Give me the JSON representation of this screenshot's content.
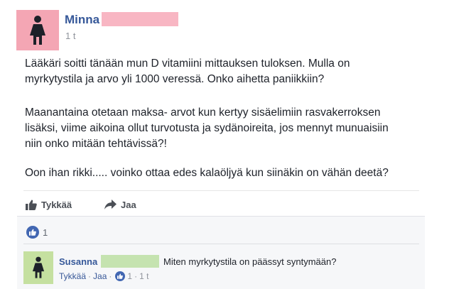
{
  "post": {
    "author": "Minna",
    "time": "1 t",
    "paragraphs": [
      [
        "Lääkäri soitti tänään mun D vitamiini mittauksen tuloksen. Mulla on",
        "myrkytystila ja arvo yli 1000 veressä. Onko aihetta paniikkiin?"
      ],
      [
        "Maanantaina otetaan maksa- arvot kun kertyy sisäelimiin rasvakerroksen",
        "lisäksi, viime aikoina ollut turvotusta ja sydänoireita, jos mennyt munuaisiin",
        "niin onko mitään tehtävissä?!"
      ],
      [
        "Oon ihan rikki..... voinko ottaa edes kalaöljyä kun siinäkin on vähän deetä?"
      ]
    ]
  },
  "actions": {
    "like_label": "Tykkää",
    "share_label": "Jaa"
  },
  "reactions": {
    "count": "1"
  },
  "comment": {
    "author": "Susanna",
    "text": "Miten myrkytystila on päässyt syntymään?",
    "like_label": "Tykkää",
    "dot1": "·",
    "reply_label": "Jaa",
    "dot2": "·",
    "likes": "1",
    "dot3": "·",
    "time": "1 t"
  },
  "colors": {
    "link": "#365899",
    "post_avatar_bg": "#f4a6b4",
    "comment_avatar_bg": "#c5e0a0",
    "like_blue": "#4267b2"
  },
  "icons": {
    "post_avatar": "female-silhouette-icon",
    "like": "thumbs-up-icon",
    "share": "share-arrow-icon"
  }
}
